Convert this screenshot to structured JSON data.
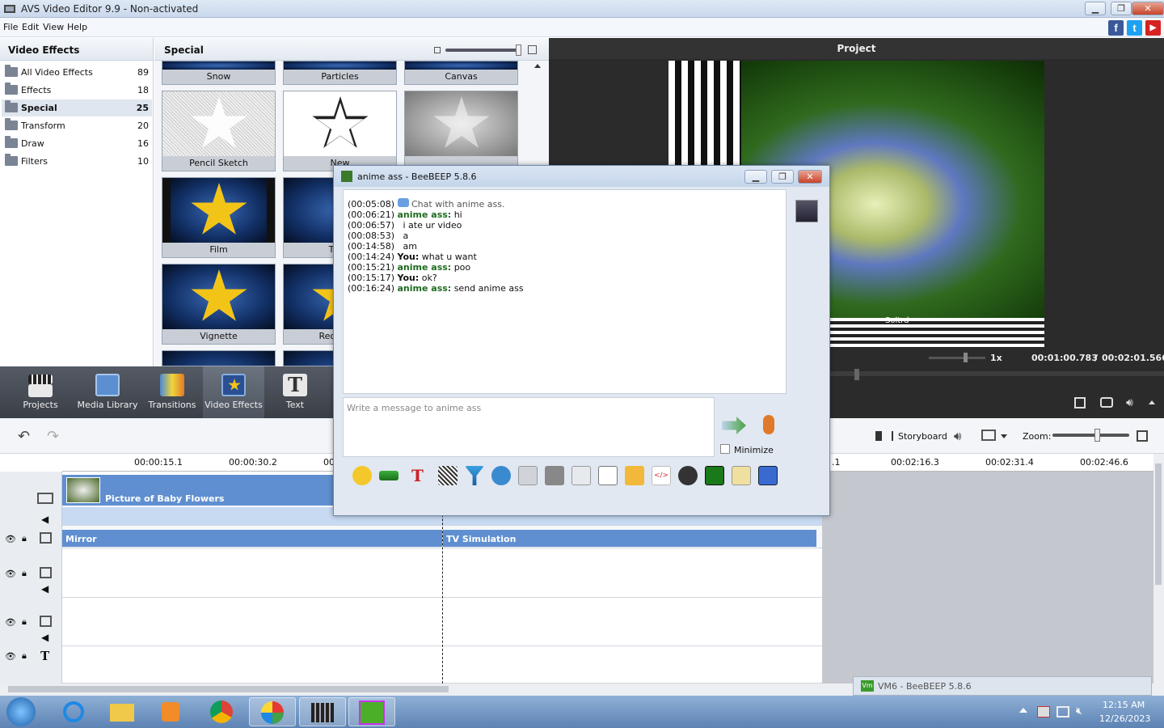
{
  "app": {
    "title": "AVS Video Editor 9.9 - Non-activated",
    "menu": [
      "File",
      "Edit",
      "View",
      "Help"
    ],
    "social": [
      "f",
      "t",
      "▶"
    ]
  },
  "left_panel": {
    "title": "Video Effects",
    "categories": [
      {
        "label": "All Video Effects",
        "count": "89"
      },
      {
        "label": "Effects",
        "count": "18"
      },
      {
        "label": "Special",
        "count": "25"
      },
      {
        "label": "Transform",
        "count": "20"
      },
      {
        "label": "Draw",
        "count": "16"
      },
      {
        "label": "Filters",
        "count": "10"
      }
    ]
  },
  "effects_panel": {
    "title": "Special",
    "thumbs": [
      "Snow",
      "Particles",
      "Canvas",
      "Pencil Sketch",
      "New",
      "Film",
      "TV Si",
      "Vignette",
      "Rectangu"
    ]
  },
  "preview": {
    "title": "Project",
    "watermark": "Soltrd",
    "speed": "1x",
    "time_current": "00:01:00.783",
    "time_sep": "/",
    "time_total": "00:02:01.566"
  },
  "toolbar": {
    "items": [
      "Projects",
      "Media Library",
      "Transitions",
      "Video Effects",
      "Text"
    ]
  },
  "timeline": {
    "storyboard": "Storyboard",
    "zoom": "Zoom:",
    "ruler_left": [
      "00:00:15.1",
      "00:00:30.2",
      "00"
    ],
    "ruler_right": [
      ".1",
      "00:02:16.3",
      "00:02:31.4",
      "00:02:46.6"
    ],
    "clip_video": "Picture of Baby Flowers",
    "clip_effect_1": "Mirror",
    "clip_effect_2": "TV Simulation"
  },
  "chat": {
    "title": "anime ass - BeeBEEP 5.8.6",
    "lines": [
      {
        "time": "(00:05:08)",
        "who": "",
        "text": "Chat with anime ass."
      },
      {
        "time": "(00:06:21)",
        "who": "anime ass:",
        "text": "hi"
      },
      {
        "time": "(00:06:57)",
        "who": "",
        "text": "i ate ur video"
      },
      {
        "time": "(00:08:53)",
        "who": "",
        "text": "a"
      },
      {
        "time": "(00:14:58)",
        "who": "",
        "text": "am"
      },
      {
        "time": "(00:14:24)",
        "who": "You:",
        "text": "what u want"
      },
      {
        "time": "(00:15:21)",
        "who": "anime ass:",
        "text": "poo"
      },
      {
        "time": "(00:15:17)",
        "who": "You:",
        "text": "ok?"
      },
      {
        "time": "(00:16:24)",
        "who": "anime ass:",
        "text": "send anime ass"
      }
    ],
    "placeholder": "Write a message to anime ass",
    "minimize": "Minimize"
  },
  "minimized_window": "VM6 - BeeBEEP 5.8.6",
  "taskbar": {
    "time": "12:15 AM",
    "date": "12/26/2023"
  }
}
